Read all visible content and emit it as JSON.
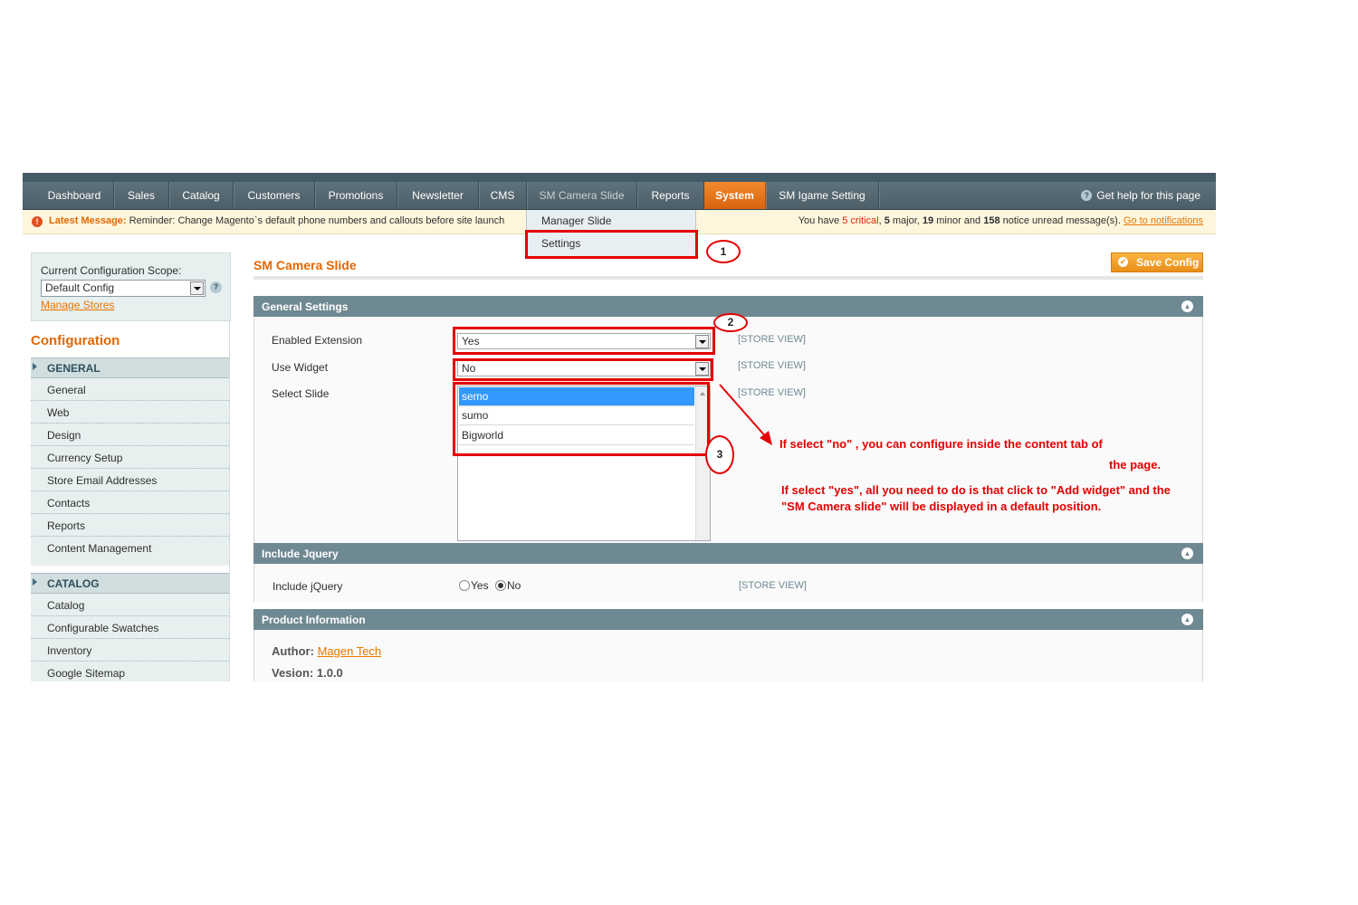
{
  "nav": {
    "items": [
      "Dashboard",
      "Sales",
      "Catalog",
      "Customers",
      "Promotions",
      "Newsletter",
      "CMS",
      "SM Camera Slide",
      "Reports",
      "System",
      "SM Igame Setting"
    ],
    "help": "Get help for this page"
  },
  "message": {
    "latest_label": "Latest Message:",
    "latest_text": "Reminder: Change Magento`s default phone numbers and callouts before site launch",
    "summary_prefix": "You have",
    "critical": "5 critical",
    "major_count": "5",
    "major_label": "major,",
    "minor_count": "19",
    "minor_label": "minor and",
    "notice_count": "158",
    "notice_label": "notice unread message(s).",
    "link": "Go to notifications"
  },
  "dropdown": {
    "items": [
      "Manager Slide",
      "Settings"
    ]
  },
  "sidebar": {
    "scope_label": "Current Configuration Scope:",
    "scope_value": "Default Config",
    "manage_stores": "Manage Stores",
    "title": "Configuration",
    "groups": [
      {
        "title": "GENERAL",
        "items": [
          "General",
          "Web",
          "Design",
          "Currency Setup",
          "Store Email Addresses",
          "Contacts",
          "Reports",
          "Content Management"
        ]
      },
      {
        "title": "CATALOG",
        "items": [
          "Catalog",
          "Configurable Swatches",
          "Inventory",
          "Google Sitemap"
        ]
      }
    ]
  },
  "main": {
    "title": "SM Camera Slide",
    "save_label": "Save Config",
    "general": {
      "header": "General Settings",
      "enabled_label": "Enabled Extension",
      "enabled_value": "Yes",
      "widget_label": "Use Widget",
      "widget_value": "No",
      "slide_label": "Select Slide",
      "slide_options": [
        "semo",
        "sumo",
        "Bigworld"
      ],
      "store_view": "[STORE VIEW]"
    },
    "jquery": {
      "header": "Include Jquery",
      "label": "Include jQuery",
      "yes": "Yes",
      "no": "No",
      "store_view": "[STORE VIEW]"
    },
    "product": {
      "header": "Product Information",
      "author_label": "Author:",
      "author_value": "Magen Tech",
      "version_label": "Vesion:",
      "version_value": "1.0.0"
    }
  },
  "annotations": {
    "step1": "1",
    "step2": "2",
    "step3": "3",
    "note_no_line1": "If select \"no\" , you can configure inside the content tab of",
    "note_no_line2": "the page.",
    "note_yes": "If select \"yes\", all you need to do is that click to \"Add widget\" and the \"SM Camera slide\" will be displayed in a default position."
  }
}
